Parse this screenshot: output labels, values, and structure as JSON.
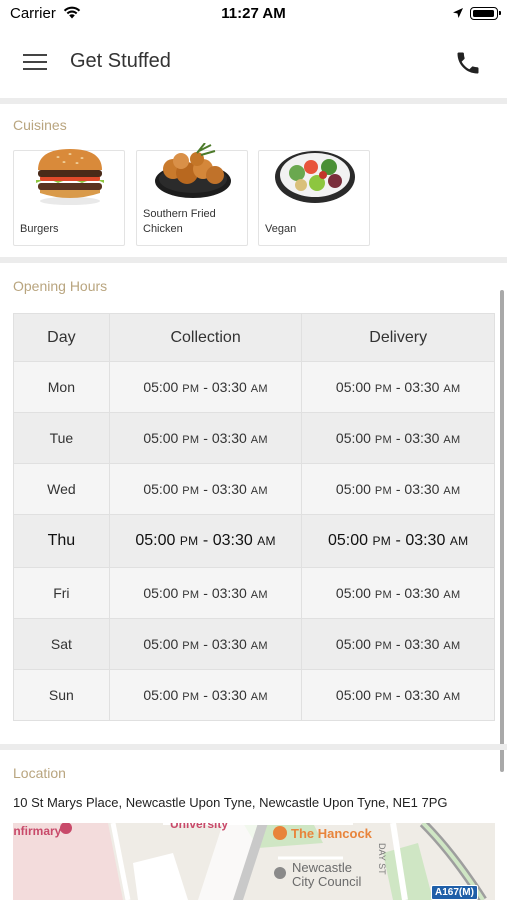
{
  "status_bar": {
    "carrier": "Carrier",
    "time": "11:27 AM"
  },
  "header": {
    "title": "Get Stuffed"
  },
  "cuisines": {
    "label": "Cuisines",
    "items": [
      {
        "name": "Burgers"
      },
      {
        "name": "Southern Fried Chicken"
      },
      {
        "name": "Vegan"
      }
    ]
  },
  "opening_hours": {
    "label": "Opening Hours",
    "columns": [
      "Day",
      "Collection",
      "Delivery"
    ],
    "rows": [
      {
        "day": "Mon",
        "collection": {
          "open": "05:00",
          "open_ampm": "PM",
          "sep": "-",
          "close": "03:30",
          "close_ampm": "AM"
        },
        "delivery": {
          "open": "05:00",
          "open_ampm": "PM",
          "sep": "-",
          "close": "03:30",
          "close_ampm": "AM"
        }
      },
      {
        "day": "Tue",
        "collection": {
          "open": "05:00",
          "open_ampm": "PM",
          "sep": "-",
          "close": "03:30",
          "close_ampm": "AM"
        },
        "delivery": {
          "open": "05:00",
          "open_ampm": "PM",
          "sep": "-",
          "close": "03:30",
          "close_ampm": "AM"
        }
      },
      {
        "day": "Wed",
        "collection": {
          "open": "05:00",
          "open_ampm": "PM",
          "sep": "-",
          "close": "03:30",
          "close_ampm": "AM"
        },
        "delivery": {
          "open": "05:00",
          "open_ampm": "PM",
          "sep": "-",
          "close": "03:30",
          "close_ampm": "AM"
        }
      },
      {
        "day": "Thu",
        "today": true,
        "collection": {
          "open": "05:00",
          "open_ampm": "PM",
          "sep": "-",
          "close": "03:30",
          "close_ampm": "AM"
        },
        "delivery": {
          "open": "05:00",
          "open_ampm": "PM",
          "sep": "-",
          "close": "03:30",
          "close_ampm": "AM"
        }
      },
      {
        "day": "Fri",
        "collection": {
          "open": "05:00",
          "open_ampm": "PM",
          "sep": "-",
          "close": "03:30",
          "close_ampm": "AM"
        },
        "delivery": {
          "open": "05:00",
          "open_ampm": "PM",
          "sep": "-",
          "close": "03:30",
          "close_ampm": "AM"
        }
      },
      {
        "day": "Sat",
        "collection": {
          "open": "05:00",
          "open_ampm": "PM",
          "sep": "-",
          "close": "03:30",
          "close_ampm": "AM"
        },
        "delivery": {
          "open": "05:00",
          "open_ampm": "PM",
          "sep": "-",
          "close": "03:30",
          "close_ampm": "AM"
        }
      },
      {
        "day": "Sun",
        "collection": {
          "open": "05:00",
          "open_ampm": "PM",
          "sep": "-",
          "close": "03:30",
          "close_ampm": "AM"
        },
        "delivery": {
          "open": "05:00",
          "open_ampm": "PM",
          "sep": "-",
          "close": "03:30",
          "close_ampm": "AM"
        }
      }
    ]
  },
  "location": {
    "label": "Location",
    "address": "10 St Marys Place, Newcastle Upon Tyne, Newcastle Upon Tyne, NE1 7PG",
    "map_labels": {
      "infirmary": "Infirmary",
      "university": "University",
      "pub": "The Hancock",
      "council_line1": "Newcastle",
      "council_line2": "City Council",
      "street": "DAY ST",
      "road": "A167(M)"
    }
  },
  "colors": {
    "section_label": "#b9a57f",
    "divider": "#ececec",
    "map_poi": "#e8843b",
    "map_road_badge": "#1f5fa8"
  }
}
